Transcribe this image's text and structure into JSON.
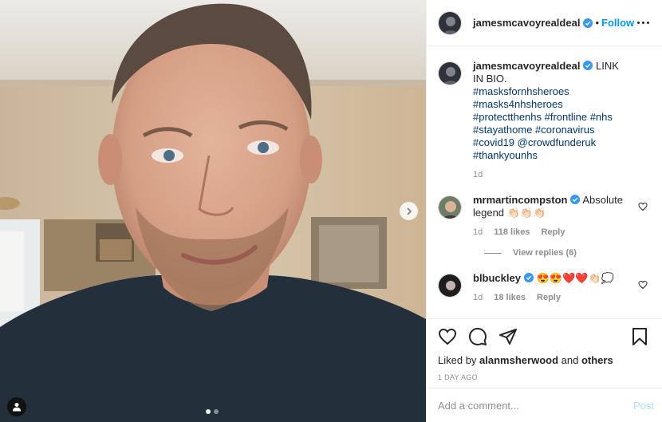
{
  "colors": {
    "accent": "#0095f6",
    "link": "#00376b",
    "muted": "#8e8e8e",
    "verified": "#3897f0",
    "text": "#262626"
  },
  "header": {
    "username": "jamesmcavoyrealdeal",
    "separator": "•",
    "follow_label": "Follow",
    "more_icon": "more-horizontal-icon"
  },
  "caption": {
    "username": "jamesmcavoyrealdeal",
    "text": "LINK IN BIO.",
    "tags": "#masksfornhsheroes #masks4nhsheroes #protectthenhs #frontline #nhs #stayathome #coronavirus #covid19 @crowdfunderuk #thankyounhs",
    "age": "1d"
  },
  "comments": [
    {
      "username": "mrmartincompston",
      "text": "Absolute legend 👏🏻👏🏻👏🏻",
      "age": "1d",
      "likes": "118 likes",
      "reply": "Reply",
      "view_replies": "View replies (6)"
    },
    {
      "username": "blbuckley",
      "text": "😍😍❤️❤️👏🏻💭",
      "age": "1d",
      "likes": "18 likes",
      "reply": "Reply"
    }
  ],
  "actions": {
    "icons": [
      "heart-icon",
      "comment-icon",
      "share-icon",
      "bookmark-icon"
    ],
    "liked_by_prefix": "Liked by",
    "liked_by_user": "alanmsherwood",
    "liked_by_and": "and",
    "liked_by_others": "others",
    "date": "1 DAY AGO"
  },
  "add_comment": {
    "placeholder": "Add a comment...",
    "post_label": "Post"
  },
  "media": {
    "carousel_index": 1,
    "carousel_count": 2
  }
}
